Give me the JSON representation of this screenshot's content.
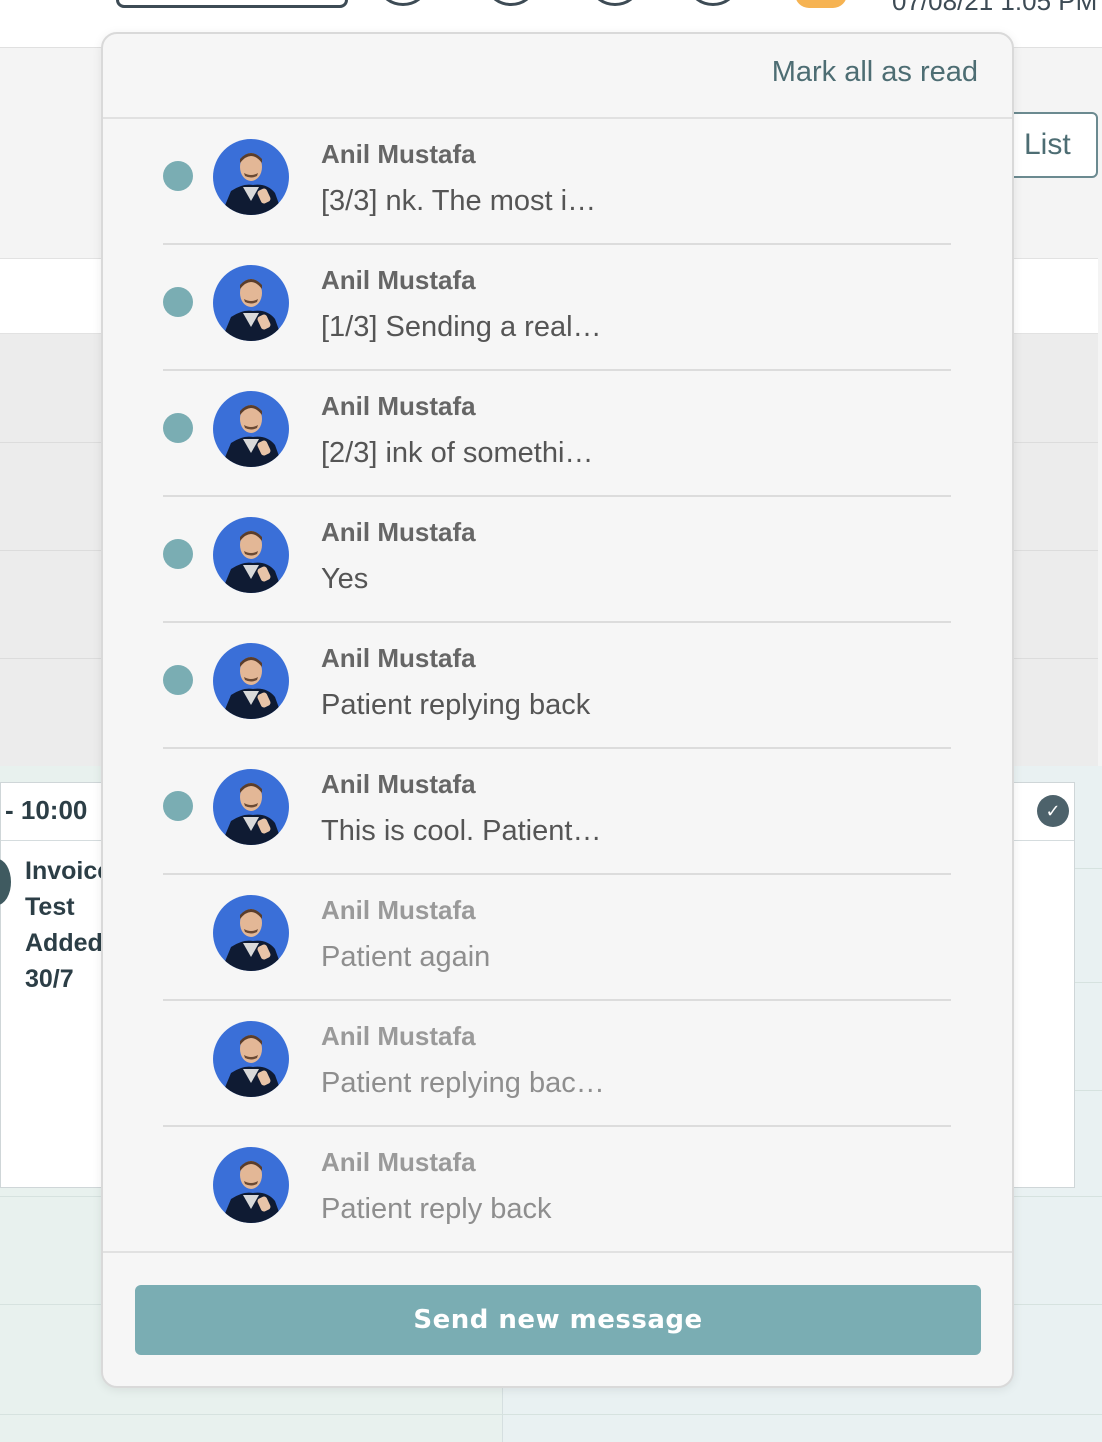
{
  "background": {
    "date_text": "07/08/21 1:05 PM",
    "list_button_label": "List",
    "event": {
      "time": "- 10:00",
      "lines": [
        "Invoice",
        "Test",
        "Added",
        "30/7"
      ]
    }
  },
  "notifications": {
    "mark_all_label": "Mark all as read",
    "send_button_label": "Send new message",
    "accent_color": "#7aadb3",
    "items": [
      {
        "sender": "Anil Mustafa",
        "preview": "[3/3] nk. The most i…",
        "unread": true
      },
      {
        "sender": "Anil Mustafa",
        "preview": "[1/3] Sending a real…",
        "unread": true
      },
      {
        "sender": "Anil Mustafa",
        "preview": "[2/3] ink of somethi…",
        "unread": true
      },
      {
        "sender": "Anil Mustafa",
        "preview": "Yes",
        "unread": true
      },
      {
        "sender": "Anil Mustafa",
        "preview": "Patient replying back",
        "unread": true
      },
      {
        "sender": "Anil Mustafa",
        "preview": "This is cool. Patient…",
        "unread": true
      },
      {
        "sender": "Anil Mustafa",
        "preview": "Patient again",
        "unread": false
      },
      {
        "sender": "Anil Mustafa",
        "preview": "Patient replying bac…",
        "unread": false
      },
      {
        "sender": "Anil Mustafa",
        "preview": "Patient reply back",
        "unread": false
      }
    ]
  }
}
